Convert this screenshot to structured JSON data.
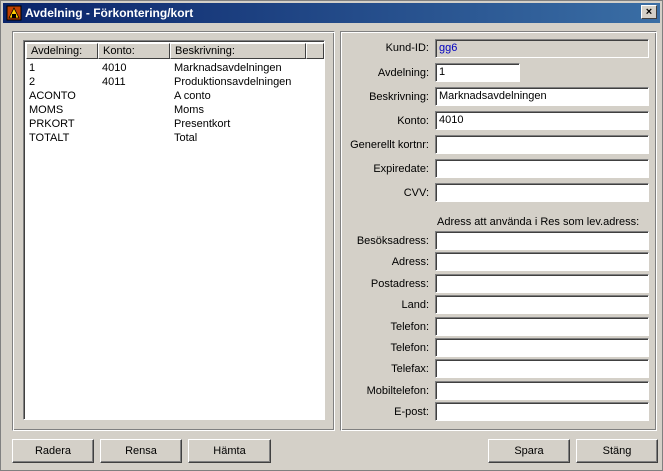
{
  "window": {
    "title": "Avdelning - Förkontering/kort",
    "close_glyph": "×"
  },
  "list": {
    "columns": [
      "Avdelning:",
      "Konto:",
      "Beskrivning:"
    ],
    "rows": [
      {
        "avdelning": "1",
        "konto": "4010",
        "beskrivning": "Marknadsavdelningen"
      },
      {
        "avdelning": "2",
        "konto": "4011",
        "beskrivning": "Produktionsavdelningen"
      },
      {
        "avdelning": "ACONTO",
        "konto": "",
        "beskrivning": "A conto"
      },
      {
        "avdelning": "MOMS",
        "konto": "",
        "beskrivning": "Moms"
      },
      {
        "avdelning": "PRKORT",
        "konto": "",
        "beskrivning": "Presentkort"
      },
      {
        "avdelning": "TOTALT",
        "konto": "",
        "beskrivning": "Total"
      }
    ]
  },
  "form": {
    "kund_id": {
      "label": "Kund-ID:",
      "value": "gg6"
    },
    "avdelning": {
      "label": "Avdelning:",
      "value": "1"
    },
    "beskrivning": {
      "label": "Beskrivning:",
      "value": "Marknadsavdelningen"
    },
    "konto": {
      "label": "Konto:",
      "value": "4010"
    },
    "generellt_kortnr": {
      "label": "Generellt kortnr:",
      "value": ""
    },
    "expiredate": {
      "label": "Expiredate:",
      "value": ""
    },
    "cvv": {
      "label": "CVV:",
      "value": ""
    },
    "address_heading": "Adress att använda i Res som lev.adress:",
    "besoksadress": {
      "label": "Besöksadress:",
      "value": ""
    },
    "adress": {
      "label": "Adress:",
      "value": ""
    },
    "postadress": {
      "label": "Postadress:",
      "value": ""
    },
    "land": {
      "label": "Land:",
      "value": ""
    },
    "telefon1": {
      "label": "Telefon:",
      "value": ""
    },
    "telefon2": {
      "label": "Telefon:",
      "value": ""
    },
    "telefax": {
      "label": "Telefax:",
      "value": ""
    },
    "mobiltelefon": {
      "label": "Mobiltelefon:",
      "value": ""
    },
    "epost": {
      "label": "E-post:",
      "value": ""
    }
  },
  "buttons": {
    "radera": "Radera",
    "rensa": "Rensa",
    "hamta": "Hämta",
    "spara": "Spara",
    "stang": "Stäng"
  }
}
